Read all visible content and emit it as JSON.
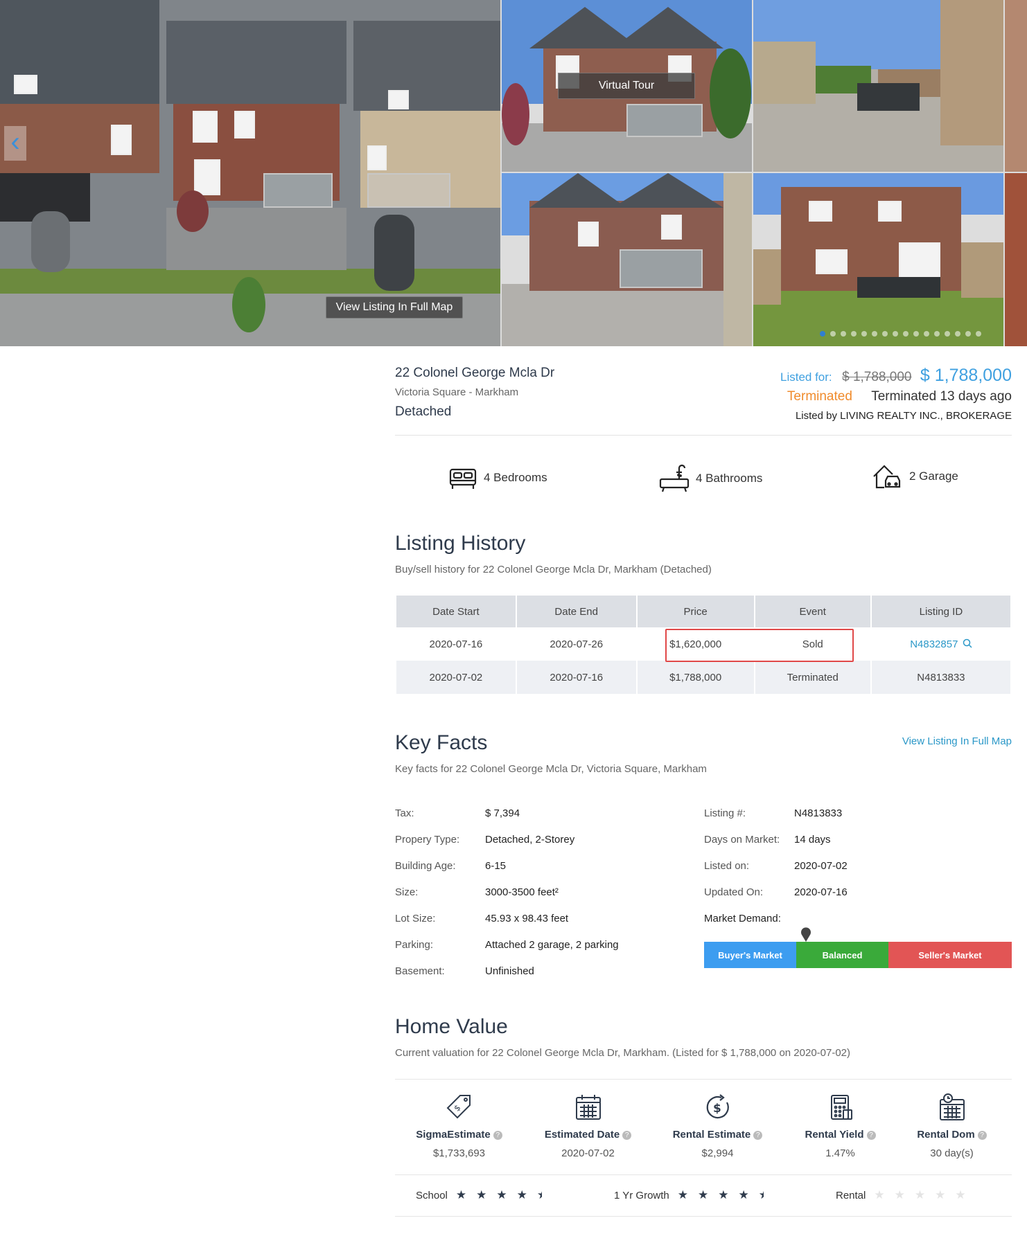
{
  "gallery": {
    "map_button": "View Listing In Full Map",
    "tour_button": "Virtual Tour",
    "prev_icon": "chevron-left-icon"
  },
  "listing": {
    "address": "22 Colonel George Mcla Dr",
    "area": "Victoria Square - Markham",
    "type": "Detached",
    "listed_for_label": "Listed for:",
    "old_price": "$ 1,788,000",
    "price": "$ 1,788,000",
    "status": "Terminated",
    "status_ago": "Terminated 13 days ago",
    "broker": "Listed by LIVING REALTY INC., BROKERAGE"
  },
  "features": {
    "bedrooms": "4 Bedrooms",
    "bathrooms": "4 Bathrooms",
    "garage": "2 Garage"
  },
  "history": {
    "title": "Listing History",
    "subtitle": "Buy/sell history for 22 Colonel George Mcla Dr, Markham (Detached)",
    "columns": [
      "Date Start",
      "Date End",
      "Price",
      "Event",
      "Listing ID"
    ],
    "rows": [
      [
        "2020-07-16",
        "2020-07-26",
        "$1,620,000",
        "Sold",
        "N4832857"
      ],
      [
        "2020-07-02",
        "2020-07-16",
        "$1,788,000",
        "Terminated",
        "N4813833"
      ]
    ]
  },
  "keyfacts": {
    "title": "Key Facts",
    "subtitle": "Key facts for 22 Colonel George Mcla Dr, Victoria Square, Markham",
    "map_link": "View Listing In Full Map",
    "left": [
      {
        "label": "Tax:",
        "value": "$ 7,394"
      },
      {
        "label": "Propery Type:",
        "value": "Detached, 2-Storey"
      },
      {
        "label": "Building Age:",
        "value": "6-15"
      },
      {
        "label": "Size:",
        "value": "3000-3500 feet²"
      },
      {
        "label": "Lot Size:",
        "value": "45.93 x 98.43 feet"
      },
      {
        "label": "Parking:",
        "value": "Attached 2 garage, 2 parking"
      },
      {
        "label": "Basement:",
        "value": "Unfinished"
      }
    ],
    "right": [
      {
        "label": "Listing #:",
        "value": "N4813833"
      },
      {
        "label": "Days on Market:",
        "value": "14 days"
      },
      {
        "label": "Listed on:",
        "value": "2020-07-02"
      },
      {
        "label": "Updated On:",
        "value": "2020-07-16"
      },
      {
        "label": "Market Demand:",
        "value": ""
      }
    ],
    "demand": {
      "buyers": "Buyer's Market",
      "balanced": "Balanced",
      "sellers": "Seller's Market",
      "colors": {
        "buyers": "#3d9df0",
        "balanced": "#3aaa3a",
        "sellers": "#e25555"
      }
    }
  },
  "homevalue": {
    "title": "Home Value",
    "subtitle": "Current valuation for 22 Colonel George Mcla Dr, Markham. (Listed for $ 1,788,000 on 2020-07-02)",
    "items": [
      {
        "label": "SigmaEstimate",
        "value": "$1,733,693",
        "icon": "price-tag-icon"
      },
      {
        "label": "Estimated Date",
        "value": "2020-07-02",
        "icon": "calendar-icon"
      },
      {
        "label": "Rental Estimate",
        "value": "$2,994",
        "icon": "dollar-cycle-icon"
      },
      {
        "label": "Rental Yield",
        "value": "1.47%",
        "icon": "calculator-icon"
      },
      {
        "label": "Rental Dom",
        "value": "30 day(s)",
        "icon": "calendar-clock-icon"
      }
    ],
    "ratings": {
      "school": {
        "label": "School",
        "stars": 4.5
      },
      "growth": {
        "label": "1 Yr Growth",
        "stars": 4.5
      },
      "rental": {
        "label": "Rental",
        "stars": 0
      }
    }
  }
}
